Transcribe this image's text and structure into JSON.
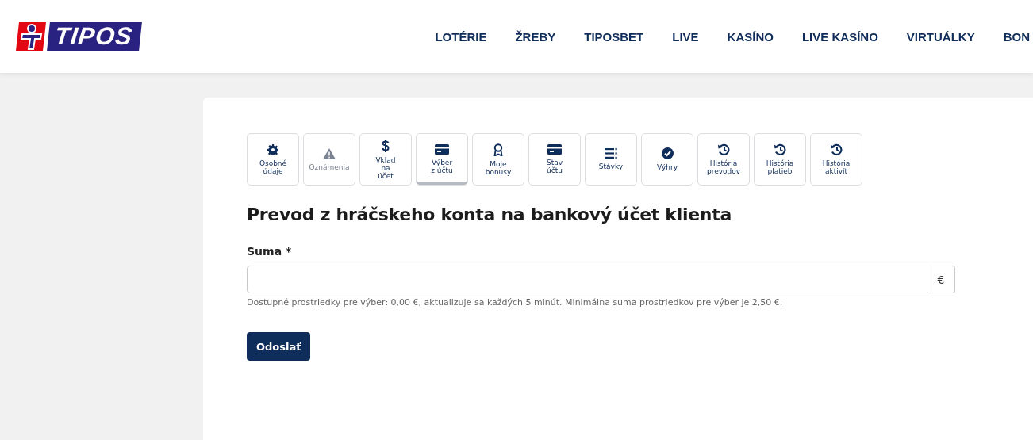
{
  "logo": {
    "text": "TIPOS"
  },
  "nav": [
    "LOTÉRIE",
    "ŽREBY",
    "TIPOSBET",
    "LIVE",
    "KASÍNO",
    "LIVE KASÍNO",
    "VIRTUÁLKY",
    "BON"
  ],
  "tabs": [
    {
      "kind": "gear",
      "lines": [
        "Osobné",
        "údaje"
      ],
      "selected": false,
      "disabled": false
    },
    {
      "kind": "warning",
      "lines": [
        "Oznámenia"
      ],
      "selected": false,
      "disabled": true
    },
    {
      "kind": "dollar",
      "lines": [
        "Vklad",
        "na",
        "účet"
      ],
      "selected": false,
      "disabled": false
    },
    {
      "kind": "card",
      "lines": [
        "Výber",
        "z účtu"
      ],
      "selected": true,
      "disabled": false
    },
    {
      "kind": "award",
      "lines": [
        "Moje",
        "bonusy"
      ],
      "selected": false,
      "disabled": false
    },
    {
      "kind": "card",
      "lines": [
        "Stav",
        "účtu"
      ],
      "selected": false,
      "disabled": false
    },
    {
      "kind": "list",
      "lines": [
        "Stávky"
      ],
      "selected": false,
      "disabled": false
    },
    {
      "kind": "check",
      "lines": [
        "Výhry"
      ],
      "selected": false,
      "disabled": false
    },
    {
      "kind": "history",
      "lines": [
        "História",
        "prevodov"
      ],
      "selected": false,
      "disabled": false
    },
    {
      "kind": "history",
      "lines": [
        "História",
        "platieb"
      ],
      "selected": false,
      "disabled": false
    },
    {
      "kind": "history",
      "lines": [
        "História",
        "aktivít"
      ],
      "selected": false,
      "disabled": false
    }
  ],
  "heading": "Prevod z hráčskeho konta na bankový účet klienta",
  "amount_field": {
    "label": "Suma *",
    "currency": "€",
    "hint": "Dostupné prostriedky pre výber: 0,00 €, aktualizuje sa každých 5 minút. Minimálna suma prostriedkov pre výber je 2,50 €."
  },
  "submit_button": "Odoslať"
}
